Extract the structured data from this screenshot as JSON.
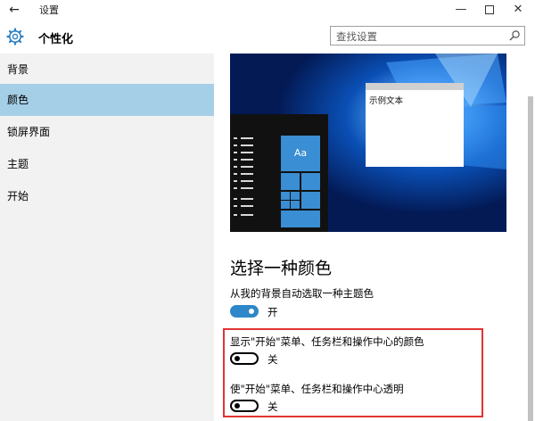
{
  "window": {
    "title": "设置",
    "back_icon": "arrow-left-icon",
    "minimize_icon": "minimize-icon",
    "maximize_icon": "maximize-icon",
    "close_icon": "close-icon"
  },
  "header": {
    "title": "个性化",
    "icon": "gear-icon",
    "search_placeholder": "查找设置",
    "search_icon": "search-icon"
  },
  "sidebar": {
    "items": [
      {
        "label": "背景",
        "selected": false
      },
      {
        "label": "颜色",
        "selected": true
      },
      {
        "label": "锁屏界面",
        "selected": false
      },
      {
        "label": "主题",
        "selected": false
      },
      {
        "label": "开始",
        "selected": false
      }
    ]
  },
  "preview": {
    "sample_text": "示例文本",
    "tile_text": "Aa"
  },
  "main": {
    "section_title": "选择一种颜色",
    "settings": [
      {
        "label": "从我的背景自动选取一种主题色",
        "toggle_state": "开",
        "on": true
      },
      {
        "label": "显示\"开始\"菜单、任务栏和操作中心的颜色",
        "toggle_state": "关",
        "on": false
      },
      {
        "label": "使\"开始\"菜单、任务栏和操作中心透明",
        "toggle_state": "关",
        "on": false
      }
    ]
  },
  "colors": {
    "accent": "#2d87c8",
    "selected_nav": "#a5cfe7",
    "highlight_box": "#e23232"
  }
}
